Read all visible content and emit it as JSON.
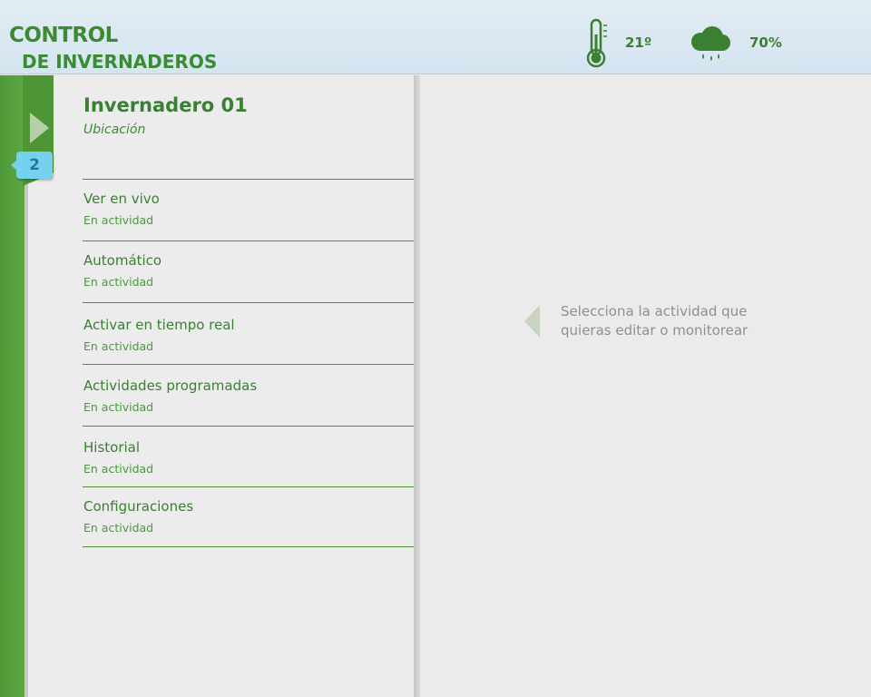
{
  "header": {
    "logo_line1": "CONTROL",
    "logo_line2": "DE INVERNADEROS",
    "temperature": "21º",
    "humidity": "70%",
    "temperature_icon": "thermometer-icon",
    "humidity_icon": "rain-cloud-icon"
  },
  "sidebar": {
    "expand_icon": "chevron-right-icon",
    "badge_count": "2"
  },
  "greenhouse": {
    "title": "Invernadero 01",
    "subtitle": "Ubicación"
  },
  "menu": {
    "items": [
      {
        "label": "Ver en vivo",
        "status": "En actividad"
      },
      {
        "label": "Automático",
        "status": "En actividad"
      },
      {
        "label": "Activar en tiempo real",
        "status": "En actividad"
      },
      {
        "label": "Actividades programadas",
        "status": "En actividad"
      },
      {
        "label": "Historial",
        "status": "En actividad"
      },
      {
        "label": "Configuraciones",
        "status": "En actividad"
      }
    ]
  },
  "detail": {
    "hint_line1": "Selecciona la actividad que",
    "hint_line2": "quieras editar o monitorear",
    "arrow_icon": "chevron-left-icon"
  },
  "colors": {
    "brand_green": "#3a7f32",
    "strip_green": "#5ea843",
    "badge_blue": "#76d1ee",
    "header_bg": "#d8e7f2"
  }
}
